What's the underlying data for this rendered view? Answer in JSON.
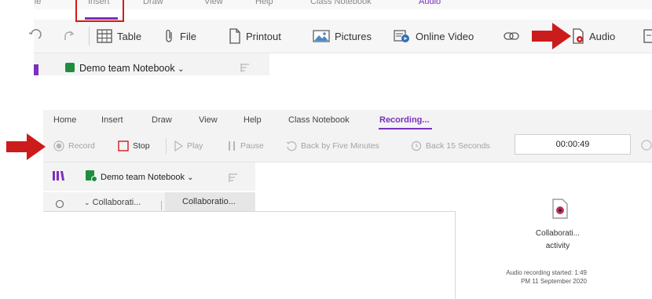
{
  "top": {
    "tabs": [
      "Home",
      "Insert",
      "Draw",
      "View",
      "Help",
      "Class Notebook",
      "Audio"
    ],
    "toolbar": {
      "table": "Table",
      "file": "File",
      "printout": "Printout",
      "pictures": "Pictures",
      "online_video": "Online Video",
      "audio": "Audio"
    },
    "notebook_name": "Demo team Notebook"
  },
  "bottom": {
    "tabs": {
      "home": "Home",
      "insert": "Insert",
      "draw": "Draw",
      "view": "View",
      "help": "Help",
      "class_notebook": "Class Notebook",
      "recording": "Recording..."
    },
    "toolbar": {
      "record": "Record",
      "stop": "Stop",
      "play": "Play",
      "pause": "Pause",
      "back_five": "Back by Five Minutes",
      "back_15": "Back 15 Seconds"
    },
    "timer": "00:00:49",
    "notebook_name": "Demo team Notebook",
    "section_1": "Collaborati...",
    "section_2": "Collaboratio...",
    "attachment_line1": "Collaborati...",
    "attachment_line2": "activity",
    "recording_info_line1": "Audio recording started: 1:49",
    "recording_info_line2": "PM 11 September 2020"
  },
  "colors": {
    "highlight_red": "#d21b1b",
    "accent_purple": "#7b2fbe",
    "onenote_green": "#1e8e3e"
  }
}
